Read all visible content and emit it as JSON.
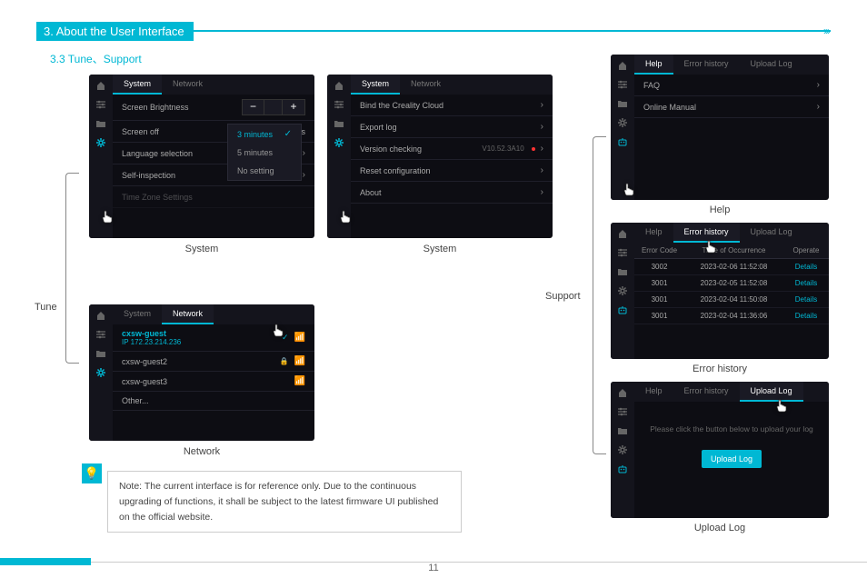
{
  "header": {
    "section_title": "3. About the User Interface",
    "subsection": "3.3 Tune、Support"
  },
  "labels": {
    "tune": "Tune",
    "support": "Support"
  },
  "screen1": {
    "tabs": {
      "system": "System",
      "network": "Network"
    },
    "rows": {
      "brightness": "Screen Brightness",
      "screen_off": "Screen off",
      "screen_off_val": "3 minutes",
      "language": "Language selection",
      "selfinsp": "Self-inspection",
      "timezone": "Time Zone Settings"
    },
    "dropdown": {
      "opt1": "3 minutes",
      "opt2": "5 minutes",
      "opt3": "No setting"
    }
  },
  "screen2": {
    "tabs": {
      "system": "System",
      "network": "Network"
    },
    "rows": {
      "bind": "Bind the Creality Cloud",
      "export": "Export log",
      "version": "Version checking",
      "version_val": "V10.52.3A10",
      "reset": "Reset configuration",
      "about": "About"
    }
  },
  "screen3": {
    "tabs": {
      "system": "System",
      "network": "Network"
    },
    "wifi": {
      "ssid1": "cxsw-guest",
      "ip1": "IP 172.23.214.236",
      "ssid2": "cxsw-guest2",
      "ssid3": "cxsw-guest3",
      "other": "Other..."
    }
  },
  "screen4": {
    "tabs": {
      "help": "Help",
      "error": "Error history",
      "upload": "Upload Log"
    },
    "rows": {
      "faq": "FAQ",
      "manual": "Online Manual"
    }
  },
  "screen5": {
    "tabs": {
      "help": "Help",
      "error": "Error history",
      "upload": "Upload Log"
    },
    "headers": {
      "code": "Error Code",
      "time": "Time of Occurrence",
      "op": "Operate"
    },
    "rows": [
      {
        "code": "3002",
        "time": "2023-02-06 11:52:08",
        "op": "Details"
      },
      {
        "code": "3001",
        "time": "2023-02-05 11:52:08",
        "op": "Details"
      },
      {
        "code": "3001",
        "time": "2023-02-04 11:50:08",
        "op": "Details"
      },
      {
        "code": "3001",
        "time": "2023-02-04 11:36:06",
        "op": "Details"
      }
    ]
  },
  "screen6": {
    "tabs": {
      "help": "Help",
      "error": "Error history",
      "upload": "Upload Log"
    },
    "msg": "Please click the button below to upload your log",
    "btn": "Upload Log"
  },
  "captions": {
    "s1": "System",
    "s2": "System",
    "s3": "Network",
    "s4": "Help",
    "s5": "Error history",
    "s6": "Upload Log"
  },
  "note": "Note: The current interface is for reference only. Due to the continuous upgrading of functions, it shall be subject to the latest firmware UI published on the official website.",
  "page_number": "11"
}
